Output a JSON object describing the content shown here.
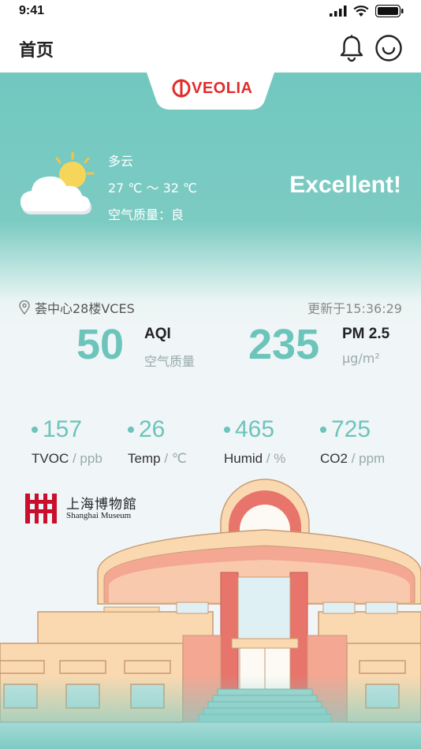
{
  "status_bar": {
    "time": "9:41"
  },
  "header": {
    "title": "首页",
    "icons": [
      "bell-icon",
      "smiley-face-icon"
    ]
  },
  "brand": {
    "logo_text": "VEOLIA",
    "color": "#e12c2c"
  },
  "weather": {
    "condition": "多云",
    "temperature": "27 ℃ ～ 32 ℃",
    "air_quality": "空气质量：良",
    "rating": "Excellent!"
  },
  "location": {
    "name": "荟中心28楼VCES",
    "updated": "更新于15:36:29"
  },
  "primary_metrics": {
    "aqi": {
      "value": "50",
      "label": "AQI",
      "sub": "空气质量"
    },
    "pm25": {
      "value": "235",
      "label": "PM 2.5",
      "sub": "μg/m²"
    }
  },
  "metrics": [
    {
      "value": "157",
      "label": "TVOC",
      "unit": "/ ppb"
    },
    {
      "value": "26",
      "label": "Temp",
      "unit": "/ ℃"
    },
    {
      "value": "465",
      "label": "Humid",
      "unit": "/ %"
    },
    {
      "value": "725",
      "label": "CO2",
      "unit": "/ ppm"
    }
  ],
  "museum": {
    "name_cn": "上海博物館",
    "name_en": "Shanghai Museum"
  },
  "colors": {
    "teal": "#6cc4bb",
    "background": "#f0f5f7",
    "building_peach": "#fbd9b0",
    "building_red": "#e8756c"
  }
}
